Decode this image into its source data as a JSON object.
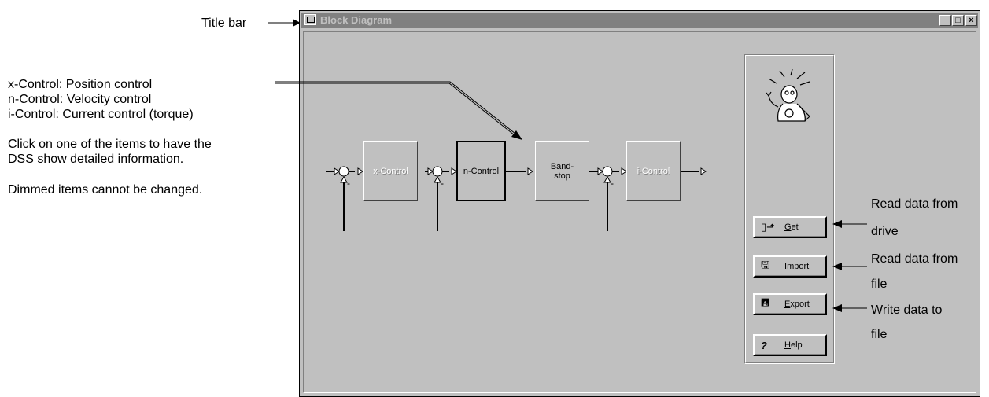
{
  "annotations": {
    "title_bar": "Title bar",
    "legend": [
      "x-Control: Position control",
      "n-Control: Velocity control",
      "i-Control:  Current control (torque)"
    ],
    "click_hint_1": "Click on one of the items to have the",
    "click_hint_2": "DSS show detailed information.",
    "dimmed_note": "Dimmed items cannot be changed.",
    "get_note_1": "Read data from",
    "get_note_2": "drive",
    "import_note_1": "Read data from",
    "import_note_2": "file",
    "export_note_1": "Write data to",
    "export_note_2": "file"
  },
  "window": {
    "title": "Block Diagram",
    "minimize": "_",
    "maximize": "□",
    "close": "×"
  },
  "diagram": {
    "blocks": {
      "x_control": "x-Control",
      "n_control": "n-Control",
      "bandstop_1": "Band-",
      "bandstop_2": "stop",
      "i_control": "i-Control"
    },
    "minus": "-"
  },
  "panel": {
    "get": "Get",
    "import": "Import",
    "export": "Export",
    "help": "Help"
  },
  "colors": {
    "window_bg": "#c0c0c0",
    "titlebar_inactive": "#808080",
    "dimmed_text": "#ffffff"
  }
}
